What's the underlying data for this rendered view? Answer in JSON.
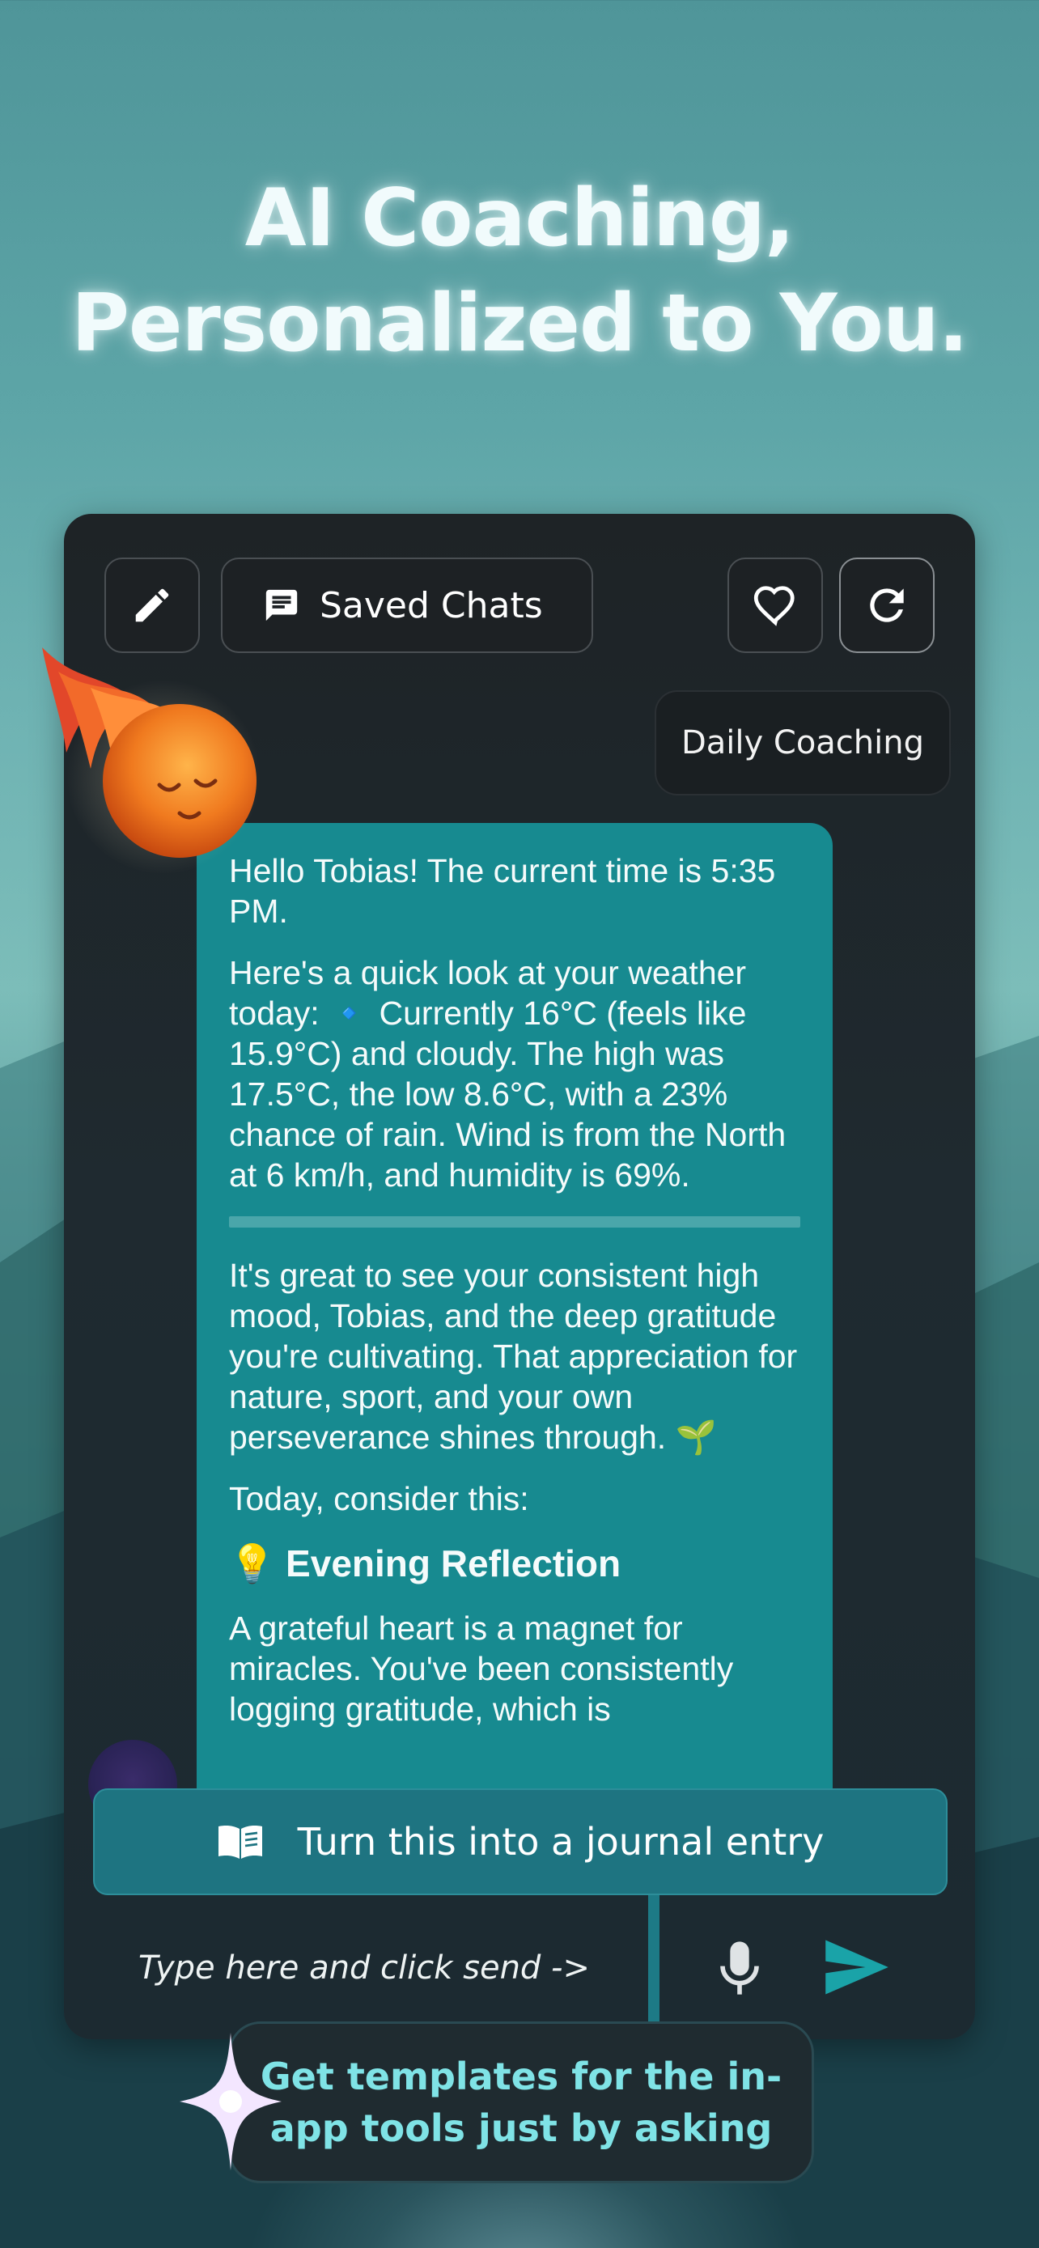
{
  "headline": {
    "line1": "AI Coaching,",
    "line2": "Personalized to You."
  },
  "toolbar": {
    "saved_chats_label": "Saved Chats"
  },
  "chat": {
    "mode_label": "Daily Coaching",
    "message": {
      "p1": "Hello Tobias! The current time is 5:35 PM.",
      "p2": "Here's a quick look at your weather today: 🔹 Currently 16°C (feels like 15.9°C) and cloudy. The high was 17.5°C, the low 8.6°C, with a 23% chance of rain. Wind is from the North at 6 km/h, and humidity is 69%.",
      "p3": "It's great to see your consistent high mood, Tobias, and the deep gratitude you're cultivating. That appreciation for nature, sport, and your own perseverance shines through. 🌱",
      "p4": "Today, consider this:",
      "heading": "💡 Evening Reflection",
      "p5": "A grateful heart is a magnet for miracles. You've been consistently logging gratitude, which is"
    }
  },
  "journal_button_label": "Turn this into a journal entry",
  "input": {
    "placeholder": "Type here and click send ->"
  },
  "tip": {
    "line1": "Get templates for the in-",
    "line2": "app tools just by asking"
  },
  "colors": {
    "accent_teal": "#178a90",
    "send_icon": "#1aa3a8",
    "tip_text": "#7fe3e6"
  }
}
